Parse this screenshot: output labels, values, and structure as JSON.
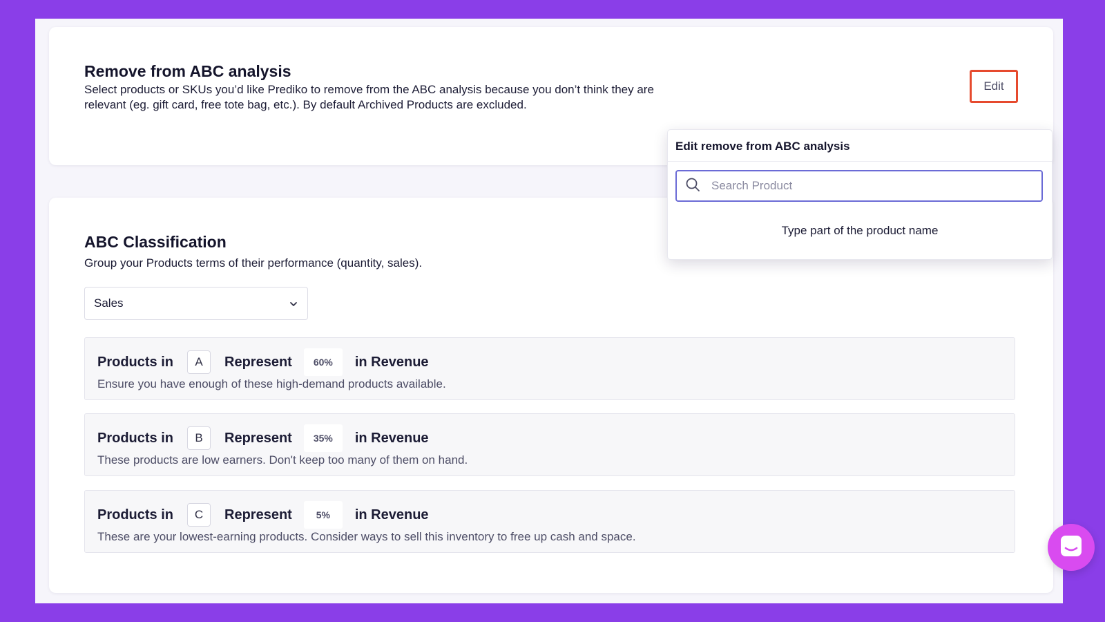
{
  "remove_section": {
    "title": "Remove from ABC analysis",
    "description_line1": "Select products or SKUs you’d like Prediko to remove from the ABC analysis because you don’t think they are",
    "description_line2": "relevant (eg. gift card, free tote bag, etc.). By default Archived Products are excluded.",
    "edit_label": "Edit"
  },
  "popover": {
    "title": "Edit remove from ABC analysis",
    "search_placeholder": "Search Product",
    "hint": "Type part of the product name",
    "search_icon": "search-icon"
  },
  "classification": {
    "title": "ABC Classification",
    "description": "Group your Products terms of their performance (quantity, sales).",
    "selected_metric": "Sales",
    "rows": [
      {
        "prefix": "Products in",
        "letter": "A",
        "represent": "Represent",
        "percent": "60%",
        "suffix": "in Revenue",
        "description": "Ensure you have enough of these high-demand products available."
      },
      {
        "prefix": "Products in",
        "letter": "B",
        "represent": "Represent",
        "percent": "35%",
        "suffix": "in Revenue",
        "description": "These products are low earners. Don't keep too many of them on hand."
      },
      {
        "prefix": "Products in",
        "letter": "C",
        "represent": "Represent",
        "percent": "5%",
        "suffix": "in Revenue",
        "description": "These are your lowest-earning products. Consider ways to sell this inventory to free up cash and space."
      }
    ]
  },
  "colors": {
    "background": "#8a3ee8",
    "edit_highlight": "#e64a2e",
    "search_border": "#6b6bd6",
    "chat_button": "#d94bf0"
  }
}
